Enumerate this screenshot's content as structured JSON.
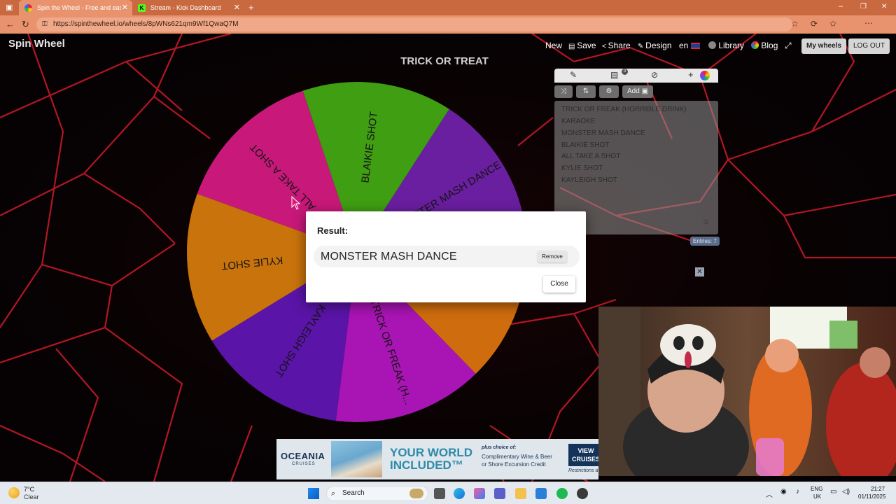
{
  "browser": {
    "tabs": [
      {
        "title": "Spin the Wheel - Free and easy-t",
        "active": true
      },
      {
        "title": "Stream - Kick Dashboard",
        "active": false
      }
    ],
    "new_tab_label": "+",
    "url": "https://spinthewheel.io/wheels/8pWNs621qm9Wf1QwaQ7M",
    "window_controls": [
      "–",
      "❐",
      "✕"
    ]
  },
  "site": {
    "logo": "Spin Wheel",
    "nav": {
      "new": "New",
      "save": "Save",
      "share": "Share",
      "design": "Design",
      "lang": "en",
      "library": "Library",
      "blog": "Blog",
      "my_wheels": "My wheels",
      "logout": "LOG OUT"
    }
  },
  "wheel": {
    "title": "TRICK OR TREAT",
    "segments": [
      {
        "label": "ALL TAKE A SHOT",
        "color": "#c8187a"
      },
      {
        "label": "BLAIKIE SHOT",
        "color": "#3f9e12"
      },
      {
        "label": "MONSTER MASH DANCE",
        "color": "#6a1ea0"
      },
      {
        "label": "KARAOKE",
        "color": "#cf6d0e"
      },
      {
        "label": "TRICK OR FREAK (H...",
        "color": "#a914b4"
      },
      {
        "label": "KAYLEIGH SHOT",
        "color": "#5a14a8"
      },
      {
        "label": "KYLIE SHOT",
        "color": "#c9730c"
      }
    ]
  },
  "panel": {
    "tabs": {
      "edit_icon": "pencil-icon",
      "list_badge": "0",
      "hide_icon": "eye-off-icon",
      "add_label": "+"
    },
    "tools": {
      "shuffle_icon": "shuffle-icon",
      "sort_icon": "sort-icon",
      "settings_icon": "gear-icon",
      "add_label": "Add"
    },
    "entries": [
      "TRICK OR FREAK (HORRIBLE DRINK)",
      "KARAOKE",
      "MONSTER MASH DANCE",
      "BLAIKIE SHOT",
      "ALL TAKE A SHOT",
      "KYLIE SHOT",
      "KAYLEIGH SHOT"
    ],
    "entries_count": "Entries: 7"
  },
  "modal": {
    "heading": "Result:",
    "result": "MONSTER MASH DANCE",
    "remove": "Remove",
    "close": "Close"
  },
  "ad": {
    "brand": "OCEANIA",
    "brand_sub": "CRUISES",
    "headline_1": "YOUR WORLD",
    "headline_2": "INCLUDED™",
    "line_1": "plus choice of:",
    "line_2": "Complimentary Wine & Beer",
    "line_3": "or Shore Excursion Credit",
    "cta": "VIEW CRUISES",
    "fine": "Restrictions a"
  },
  "taskbar": {
    "weather_temp": "7°C",
    "weather_desc": "Clear",
    "search": "Search",
    "lang_1": "ENG",
    "lang_2": "UK",
    "time": "21:27",
    "date": "01/11/2025"
  },
  "colors": {
    "tabbar": "#c9693f",
    "addressbar": "#e9936e",
    "web": "#d11a2a"
  }
}
